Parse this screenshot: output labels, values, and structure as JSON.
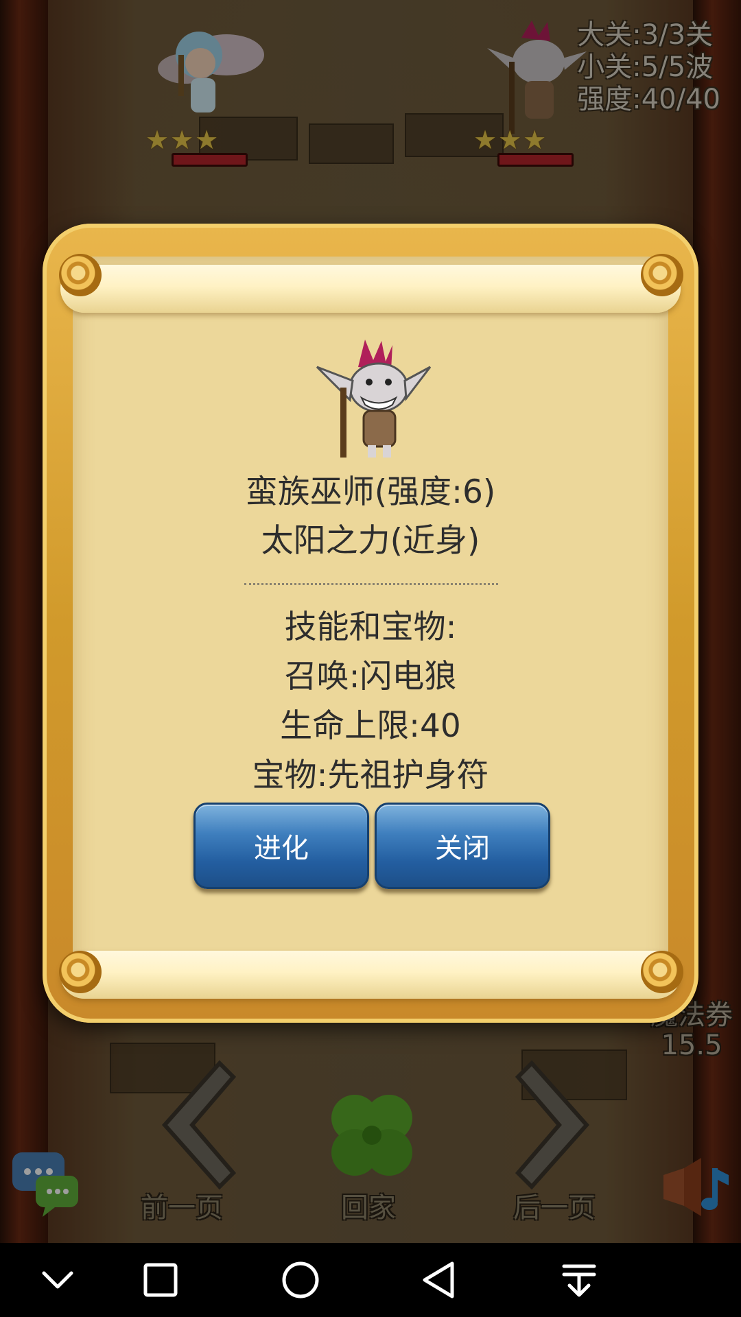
{
  "stage": {
    "big_level": "大关:3/3关",
    "small_level": "小关:5/5波",
    "strength": "强度:40/40"
  },
  "heroes": [
    {
      "name": "fairy-hero",
      "stars": 3
    },
    {
      "name": "goblin-shaman",
      "stars": 3
    }
  ],
  "dialog": {
    "unit_title": "蛮族巫师(强度:6)",
    "attack_type": "太阳之力(近身)",
    "skills_header": "技能和宝物:",
    "skill_1": "召唤:闪电狼",
    "skill_2": "生命上限:40",
    "treasure": "宝物:先祖护身符",
    "evolve_label": "进化",
    "close_label": "关闭"
  },
  "bottom_nav": {
    "prev_label": "前一页",
    "home_label": "回家",
    "next_label": "后一页"
  },
  "magic_ticket": {
    "label": "魔法券",
    "value": "15.5"
  },
  "colors": {
    "button_blue": "#2b66a8",
    "parchment": "#ecd79a",
    "frame_gold": "#d19a2b"
  }
}
